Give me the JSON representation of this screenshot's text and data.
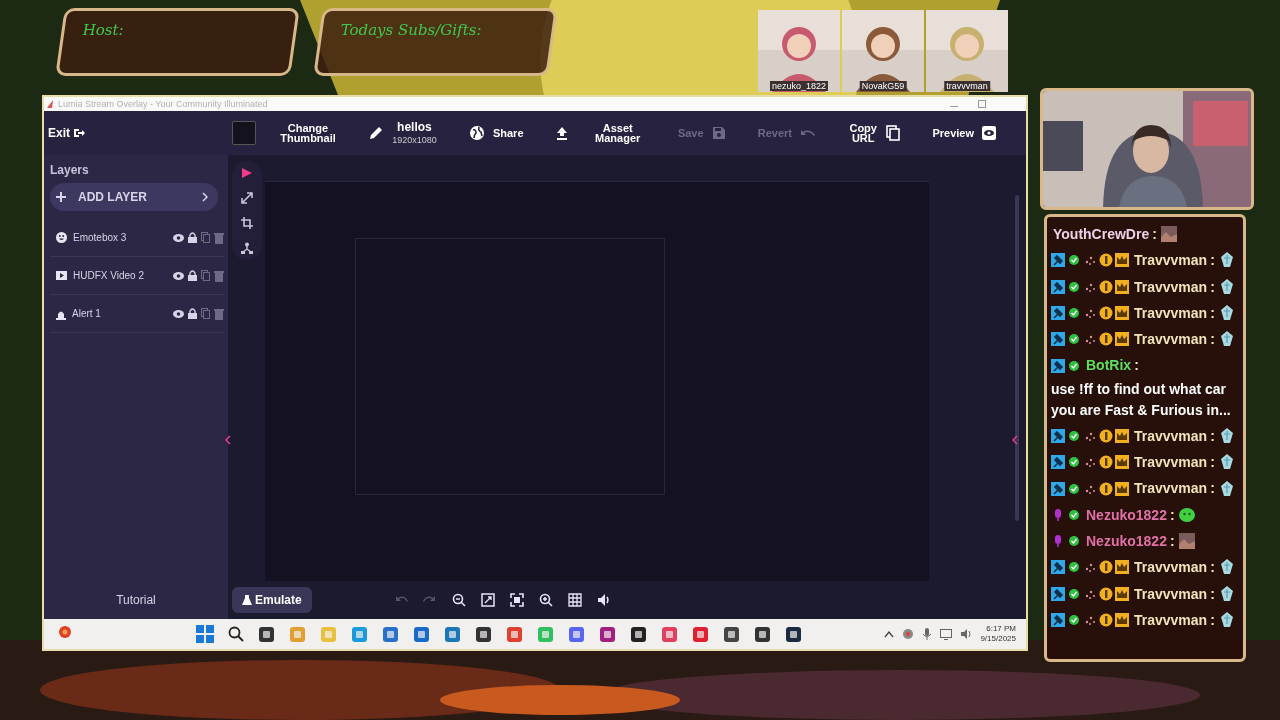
{
  "overlay": {
    "host_panel": {
      "label": "Host:"
    },
    "subs_panel": {
      "label": "Todays Subs/Gifts:"
    },
    "avatars": [
      {
        "name": "nezuko_1822"
      },
      {
        "name": "NovakG59"
      },
      {
        "name": "travvvman"
      }
    ]
  },
  "window": {
    "title": "Lumia Stream Overlay - Your Community Illuminated"
  },
  "toolbar": {
    "exit": "Exit",
    "items": [
      {
        "kind": "thumbnail",
        "label": "Change Thumbnail",
        "disabled": false
      },
      {
        "kind": "title",
        "label": "hellos",
        "sublabel": "1920x1080",
        "disabled": false
      },
      {
        "kind": "share",
        "label": "Share",
        "disabled": false
      },
      {
        "kind": "upload",
        "label": "Asset Manager",
        "disabled": false
      },
      {
        "kind": "save",
        "label": "Save",
        "disabled": true
      },
      {
        "kind": "revert",
        "label": "Revert",
        "disabled": true
      },
      {
        "kind": "copy",
        "label": "Copy URL",
        "disabled": false
      },
      {
        "kind": "preview",
        "label": "Preview",
        "disabled": false
      }
    ]
  },
  "layers": {
    "title": "Layers",
    "add_button": "ADD LAYER",
    "items": [
      {
        "kind": "emote",
        "name": "Emotebox 3"
      },
      {
        "kind": "video",
        "name": "HUDFX Video 2"
      },
      {
        "kind": "alert",
        "name": "Alert 1"
      }
    ],
    "tutorial": "Tutorial"
  },
  "tools": [
    {
      "kind": "select",
      "selected": true
    },
    {
      "kind": "resize",
      "selected": false
    },
    {
      "kind": "crop",
      "selected": false
    },
    {
      "kind": "hierarchy",
      "selected": false
    }
  ],
  "bottom_bar": {
    "emulate": "Emulate",
    "controls": [
      {
        "kind": "undo",
        "disabled": true
      },
      {
        "kind": "redo",
        "disabled": true
      },
      {
        "kind": "zoom_out",
        "disabled": false
      },
      {
        "kind": "fit",
        "disabled": false
      },
      {
        "kind": "fullscreen",
        "disabled": false
      },
      {
        "kind": "zoom_in",
        "disabled": false
      },
      {
        "kind": "grid",
        "disabled": false
      },
      {
        "kind": "sound",
        "disabled": false
      }
    ]
  },
  "taskbar": {
    "time": "6:17 PM",
    "date": "9/15/2025"
  },
  "chat": {
    "messages": [
      {
        "kind": "plain",
        "user": "YouthCrewDre",
        "color": "#eed0e8",
        "separator": ":"
      },
      {
        "kind": "sub",
        "user": "Travvvman",
        "color": "#f2e4b8",
        "separator": ":",
        "emote": {
          "kind": "crystal"
        }
      },
      {
        "kind": "sub",
        "user": "Travvvman",
        "color": "#f2e4b8",
        "separator": ":",
        "emote": {
          "kind": "crystal"
        }
      },
      {
        "kind": "sub",
        "user": "Travvvman",
        "color": "#f2e4b8",
        "separator": ":",
        "emote": {
          "kind": "crystal"
        }
      },
      {
        "kind": "sub",
        "user": "Travvvman",
        "color": "#f2e4b8",
        "separator": ":",
        "emote": {
          "kind": "crystal"
        }
      },
      {
        "kind": "bot",
        "user": "BotRix",
        "color": "#5ee05e",
        "separator": ":",
        "text": "use !ff to find out what car you are Fast & Furious in..."
      },
      {
        "kind": "sub",
        "user": "Travvvman",
        "color": "#f2e4b8",
        "separator": ":",
        "emote": {
          "kind": "crystal"
        }
      },
      {
        "kind": "sub",
        "user": "Travvvman",
        "color": "#f2e4b8",
        "separator": ":",
        "emote": {
          "kind": "crystal"
        }
      },
      {
        "kind": "sub",
        "user": "Travvvman",
        "color": "#f2e4b8",
        "separator": ":",
        "emote": {
          "kind": "crystal"
        }
      },
      {
        "kind": "vip",
        "user": "Nezuko1822",
        "color": "#e070a8",
        "separator": ":",
        "emote": {
          "kind": "blob"
        }
      },
      {
        "kind": "vip",
        "user": "Nezuko1822",
        "color": "#e070a8",
        "separator": ":"
      },
      {
        "kind": "sub",
        "user": "Travvvman",
        "color": "#f2e4b8",
        "separator": ":",
        "emote": {
          "kind": "crystal"
        }
      },
      {
        "kind": "sub",
        "user": "Travvvman",
        "color": "#f2e4b8",
        "separator": ":",
        "emote": {
          "kind": "crystal"
        }
      },
      {
        "kind": "sub",
        "user": "Travvvman",
        "color": "#f2e4b8",
        "separator": ":",
        "emote": {
          "kind": "crystal"
        }
      }
    ]
  }
}
